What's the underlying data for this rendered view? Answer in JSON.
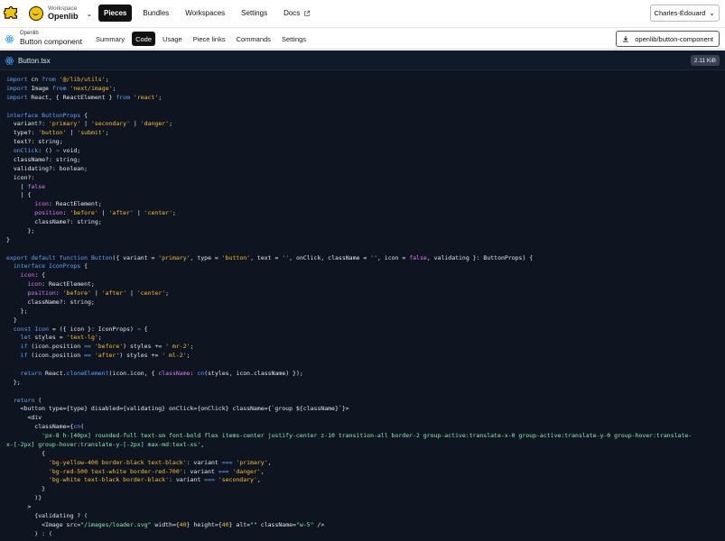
{
  "workspace": {
    "caption": "Workspace",
    "name": "Openlib"
  },
  "topnav": [
    {
      "label": "Pieces",
      "active": true
    },
    {
      "label": "Bundles",
      "active": false
    },
    {
      "label": "Workspaces",
      "active": false
    },
    {
      "label": "Settings",
      "active": false
    },
    {
      "label": "Docs",
      "active": false,
      "external": true
    }
  ],
  "user": {
    "name": "Charles-Édouard"
  },
  "piece": {
    "caption": "Openlib",
    "name": "Button component"
  },
  "subnav": [
    {
      "label": "Summary",
      "active": false
    },
    {
      "label": "Code",
      "active": true
    },
    {
      "label": "Usage",
      "active": false
    },
    {
      "label": "Piece links",
      "active": false
    },
    {
      "label": "Commands",
      "active": false
    },
    {
      "label": "Settings",
      "active": false
    }
  ],
  "install_button": {
    "label": "openlib/button-component"
  },
  "file": {
    "name": "Button.tsx",
    "size": "2.11 KiB"
  },
  "colors": {
    "brand_yellow": "#f5c400",
    "code_bg": "#0e1521",
    "keyword": "#60a5fa",
    "string": "#fbbf24",
    "property": "#e879f9",
    "class_attr": "#86efac"
  },
  "icons": {
    "logo": "puzzle-icon",
    "workspace": "smiley-icon",
    "docs": "external-link-icon",
    "piece": "react-icon",
    "install": "download-icon",
    "file": "react-icon"
  },
  "code_lines": [
    [
      [
        "s",
        "import cn from '@/lib/utils';"
      ]
    ],
    [
      [
        "k",
        "import"
      ],
      [
        "p",
        " cn "
      ],
      [
        "k",
        "from"
      ],
      [
        "p",
        " "
      ],
      [
        "s",
        "'@/lib/utils'"
      ],
      [
        "p",
        ";"
      ]
    ],
    [
      [
        "k",
        "import"
      ],
      [
        "p",
        " Image "
      ],
      [
        "k",
        "from"
      ],
      [
        "p",
        " "
      ],
      [
        "s",
        "'next/image'"
      ],
      [
        "p",
        ";"
      ]
    ],
    [
      [
        "k",
        "import"
      ],
      [
        "p",
        " React, { ReactElement } "
      ],
      [
        "k",
        "from"
      ],
      [
        "p",
        " "
      ],
      [
        "s",
        "'react'"
      ],
      [
        "p",
        ";"
      ]
    ],
    [
      [
        "p",
        ""
      ]
    ],
    [
      [
        "k",
        "interface"
      ],
      [
        "p",
        " "
      ],
      [
        "t",
        "ButtonProps"
      ],
      [
        "p",
        " {"
      ]
    ],
    [
      [
        "p",
        "  variant?: "
      ],
      [
        "s",
        "'primary'"
      ],
      [
        "p",
        " | "
      ],
      [
        "s",
        "'secondary'"
      ],
      [
        "p",
        " | "
      ],
      [
        "s",
        "'danger'"
      ],
      [
        "p",
        ";"
      ]
    ],
    [
      [
        "p",
        "  type?: "
      ],
      [
        "s",
        "'button'"
      ],
      [
        "p",
        " | "
      ],
      [
        "s",
        "'submit'"
      ],
      [
        "p",
        ";"
      ]
    ],
    [
      [
        "p",
        "  text?: string;"
      ]
    ],
    [
      [
        "k",
        "  onClick"
      ],
      [
        "p",
        ": () "
      ],
      [
        "k",
        "⇒"
      ],
      [
        "p",
        " void;"
      ]
    ],
    [
      [
        "p",
        "  className?: string;"
      ]
    ],
    [
      [
        "p",
        "  validating?: boolean;"
      ]
    ],
    [
      [
        "p",
        "  icon?:"
      ]
    ],
    [
      [
        "p",
        "    | "
      ],
      [
        "r",
        "false"
      ]
    ],
    [
      [
        "p",
        "    | {"
      ]
    ],
    [
      [
        "r",
        "        icon"
      ],
      [
        "p",
        ": ReactElement;"
      ]
    ],
    [
      [
        "r",
        "        position"
      ],
      [
        "p",
        ": "
      ],
      [
        "s",
        "'before'"
      ],
      [
        "p",
        " | "
      ],
      [
        "s",
        "'after'"
      ],
      [
        "p",
        " | "
      ],
      [
        "s",
        "'center'"
      ],
      [
        "p",
        ";"
      ]
    ],
    [
      [
        "p",
        "        className?: string;"
      ]
    ],
    [
      [
        "p",
        "      };"
      ]
    ],
    [
      [
        "p",
        "}"
      ]
    ],
    [
      [
        "p",
        ""
      ]
    ],
    [
      [
        "k",
        "export default function"
      ],
      [
        "p",
        " "
      ],
      [
        "f",
        "Button"
      ],
      [
        "p",
        "({ variant = "
      ],
      [
        "s",
        "'primary'"
      ],
      [
        "p",
        ", type = "
      ],
      [
        "s",
        "'button'"
      ],
      [
        "p",
        ", text = "
      ],
      [
        "s",
        "''"
      ],
      [
        "p",
        ", onClick, className = "
      ],
      [
        "s",
        "''"
      ],
      [
        "p",
        ", icon = "
      ],
      [
        "r",
        "false"
      ],
      [
        "p",
        ", validating }: ButtonProps) {"
      ]
    ],
    [
      [
        "k",
        "  interface"
      ],
      [
        "p",
        " "
      ],
      [
        "t",
        "IconProps"
      ],
      [
        "p",
        " {"
      ]
    ],
    [
      [
        "r",
        "    icon"
      ],
      [
        "p",
        ": {"
      ]
    ],
    [
      [
        "r",
        "      icon"
      ],
      [
        "p",
        ": ReactElement;"
      ]
    ],
    [
      [
        "r",
        "      position"
      ],
      [
        "p",
        ": "
      ],
      [
        "s",
        "'before'"
      ],
      [
        "p",
        " | "
      ],
      [
        "s",
        "'after'"
      ],
      [
        "p",
        " | "
      ],
      [
        "s",
        "'center'"
      ],
      [
        "p",
        ";"
      ]
    ],
    [
      [
        "p",
        "      className?: string;"
      ]
    ],
    [
      [
        "p",
        "    };"
      ]
    ],
    [
      [
        "p",
        "  }"
      ]
    ],
    [
      [
        "k",
        "  const"
      ],
      [
        "p",
        " "
      ],
      [
        "f",
        "Icon"
      ],
      [
        "p",
        " = ({ icon }: IconProps) "
      ],
      [
        "k",
        "⇒"
      ],
      [
        "p",
        " {"
      ]
    ],
    [
      [
        "k",
        "    let"
      ],
      [
        "p",
        " styles = "
      ],
      [
        "s",
        "'text-lg'"
      ],
      [
        "p",
        ";"
      ]
    ],
    [
      [
        "k",
        "    if"
      ],
      [
        "p",
        " (icon.position "
      ],
      [
        "k",
        "=="
      ],
      [
        "p",
        " "
      ],
      [
        "s",
        "'before'"
      ],
      [
        "p",
        ") styles += "
      ],
      [
        "s",
        "' mr-2'"
      ],
      [
        "p",
        ";"
      ]
    ],
    [
      [
        "k",
        "    if"
      ],
      [
        "p",
        " (icon.position "
      ],
      [
        "k",
        "=="
      ],
      [
        "p",
        " "
      ],
      [
        "s",
        "'after'"
      ],
      [
        "p",
        ") styles += "
      ],
      [
        "s",
        "' ml-2'"
      ],
      [
        "p",
        ";"
      ]
    ],
    [
      [
        "p",
        ""
      ]
    ],
    [
      [
        "k",
        "    return"
      ],
      [
        "p",
        " React."
      ],
      [
        "f",
        "cloneElement"
      ],
      [
        "p",
        "(icon.icon, { "
      ],
      [
        "r",
        "className"
      ],
      [
        "p",
        ": "
      ],
      [
        "f",
        "cn"
      ],
      [
        "p",
        "(styles, icon.className) });"
      ]
    ],
    [
      [
        "p",
        "  };"
      ]
    ],
    [
      [
        "p",
        ""
      ]
    ],
    [
      [
        "k",
        "  return"
      ],
      [
        "p",
        " ("
      ]
    ],
    [
      [
        "p",
        "    <button type={type} disabled={validating} onClick={onClick} className={`group ${className}`}>"
      ]
    ],
    [
      [
        "p",
        "      <div"
      ]
    ],
    [
      [
        "p",
        "        className={"
      ],
      [
        "f",
        "cn"
      ],
      [
        "p",
        "("
      ]
    ],
    [
      [
        "c",
        "          'px-8 h-[40px] rounded-full text-sm font-bold flex items-center justify-center z-10 transition-all border-2 group-active:translate-x-0 group-active:translate-y-0 group-hover:translate-"
      ]
    ],
    [
      [
        "c",
        "x-[-2px] group-hover:translate-y-[-2px] max-md:text-xs'"
      ],
      [
        "p",
        ","
      ]
    ],
    [
      [
        "p",
        "          {"
      ]
    ],
    [
      [
        "s",
        "            'bg-yellow-400 border-black text-black'"
      ],
      [
        "p",
        ": variant "
      ],
      [
        "k",
        "==="
      ],
      [
        "p",
        " "
      ],
      [
        "s",
        "'primary'"
      ],
      [
        "p",
        ","
      ]
    ],
    [
      [
        "s",
        "            'bg-red-500 text-white border-red-700'"
      ],
      [
        "p",
        ": variant "
      ],
      [
        "k",
        "==="
      ],
      [
        "p",
        " "
      ],
      [
        "s",
        "'danger'"
      ],
      [
        "p",
        ","
      ]
    ],
    [
      [
        "s",
        "            'bg-white text-black border-black'"
      ],
      [
        "p",
        ": variant "
      ],
      [
        "k",
        "==="
      ],
      [
        "p",
        " "
      ],
      [
        "s",
        "'secondary'"
      ],
      [
        "p",
        ","
      ]
    ],
    [
      [
        "p",
        "          }"
      ]
    ],
    [
      [
        "p",
        "        )}"
      ]
    ],
    [
      [
        "p",
        "      >"
      ]
    ],
    [
      [
        "p",
        "        {validating ? ("
      ]
    ],
    [
      [
        "p",
        "          <Image src="
      ],
      [
        "c",
        "\"/images/loader.svg\""
      ],
      [
        "p",
        " width={"
      ],
      [
        "n",
        "40"
      ],
      [
        "p",
        "} height={"
      ],
      [
        "n",
        "40"
      ],
      [
        "p",
        "} alt="
      ],
      [
        "c",
        "\"\""
      ],
      [
        "p",
        " className="
      ],
      [
        "c",
        "\"w-5\""
      ],
      [
        "p",
        " />"
      ]
    ],
    [
      [
        "p",
        "        ) : ("
      ]
    ]
  ]
}
